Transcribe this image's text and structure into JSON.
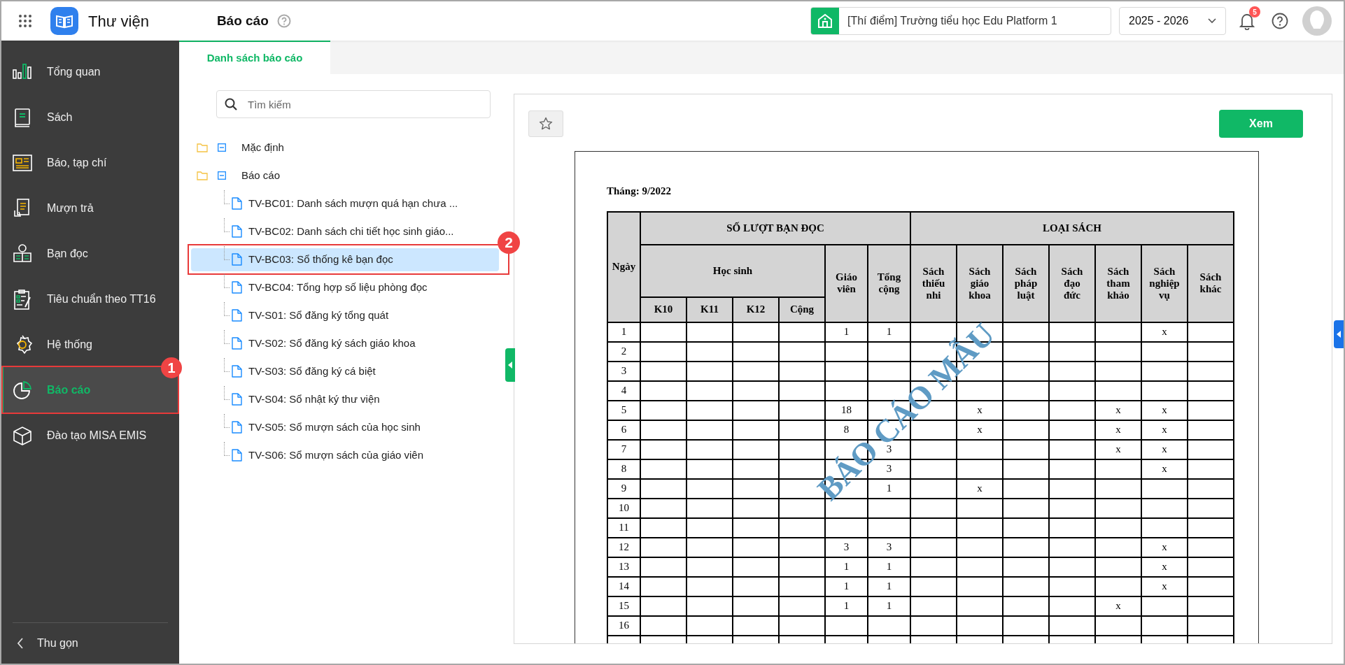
{
  "app": {
    "title": "Thư viện"
  },
  "header": {
    "page_title": "Báo cáo",
    "school": "[Thí điểm] Trường tiểu học Edu Platform 1",
    "year": "2025 - 2026",
    "notification_count": "5"
  },
  "sidebar": {
    "items": [
      {
        "label": "Tổng quan",
        "selected": false
      },
      {
        "label": "Sách",
        "selected": false
      },
      {
        "label": "Báo, tạp chí",
        "selected": false
      },
      {
        "label": "Mượn trả",
        "selected": false
      },
      {
        "label": "Bạn đọc",
        "selected": false
      },
      {
        "label": "Tiêu chuẩn theo TT16",
        "selected": false
      },
      {
        "label": "Hệ thống",
        "selected": false
      },
      {
        "label": "Báo cáo",
        "selected": true,
        "callout": "1"
      },
      {
        "label": "Đào tạo MISA EMIS",
        "selected": false
      }
    ],
    "collapse_label": "Thu gọn"
  },
  "tabs": [
    {
      "label": "Danh sách báo cáo",
      "selected": true
    }
  ],
  "search": {
    "placeholder": "Tìm kiếm"
  },
  "tree": [
    {
      "label": "Mặc định",
      "expanded": true
    },
    {
      "label": "Báo cáo",
      "expanded": true,
      "children": [
        {
          "label": "TV-BC01: Danh sách mượn quá hạn chưa ...",
          "selected": false
        },
        {
          "label": "TV-BC02: Danh sách chi tiết học sinh giáo...",
          "selected": false
        },
        {
          "label": "TV-BC03: Sổ thống kê bạn đọc",
          "selected": true,
          "callout": "2"
        },
        {
          "label": "TV-BC04: Tổng hợp số liệu phòng đọc",
          "selected": false
        },
        {
          "label": "TV-S01: Sổ đăng ký tổng quát",
          "selected": false
        },
        {
          "label": "TV-S02: Sổ đăng ký sách giáo khoa",
          "selected": false
        },
        {
          "label": "TV-S03: Sổ đăng ký cá biệt",
          "selected": false
        },
        {
          "label": "TV-S04: Sổ nhật ký thư viện",
          "selected": false
        },
        {
          "label": "TV-S05: Sổ mượn sách của học sinh",
          "selected": false
        },
        {
          "label": "TV-S06: Sổ mượn sách của giáo viên",
          "selected": false
        }
      ]
    }
  ],
  "preview": {
    "favorite": false,
    "view_button": "Xem",
    "report": {
      "month": "Tháng: 9/2022",
      "stamp": "BÁO CÁO MẪU",
      "day_header": "Ngày",
      "readers_header": "SỐ LƯỢT BẠN ĐỌC",
      "book_types_header": "LOẠI SÁCH",
      "student_header": "Học sinh",
      "student_columns": [
        "K10",
        "K11",
        "K12",
        "Cộng"
      ],
      "teacher_header": "Giáo viên",
      "total_header": "Tổng cộng",
      "book_types": [
        "Sách thiếu nhi",
        "Sách giáo khoa",
        "Sách pháp luật",
        "Sách đạo đức",
        "Sách tham khảo",
        "Sách nghiệp vụ",
        "Sách khác"
      ],
      "rows": [
        {
          "day": "1",
          "cells": [
            null,
            null,
            null,
            null,
            "1",
            "1",
            null,
            null,
            null,
            null,
            null,
            "x",
            null
          ]
        },
        {
          "day": "2",
          "cells": [
            null,
            null,
            null,
            null,
            null,
            null,
            null,
            null,
            null,
            null,
            null,
            null,
            null
          ]
        },
        {
          "day": "3",
          "cells": [
            null,
            null,
            null,
            null,
            null,
            null,
            null,
            null,
            null,
            null,
            null,
            null,
            null
          ]
        },
        {
          "day": "4",
          "cells": [
            null,
            null,
            null,
            null,
            null,
            null,
            null,
            null,
            null,
            null,
            null,
            null,
            null
          ]
        },
        {
          "day": "5",
          "cells": [
            null,
            null,
            null,
            null,
            "18",
            null,
            null,
            "x",
            null,
            null,
            "x",
            "x",
            null
          ]
        },
        {
          "day": "6",
          "cells": [
            null,
            null,
            null,
            null,
            "8",
            null,
            null,
            "x",
            null,
            null,
            "x",
            "x",
            null
          ]
        },
        {
          "day": "7",
          "cells": [
            null,
            null,
            null,
            null,
            null,
            "3",
            null,
            null,
            null,
            null,
            "x",
            "x",
            null
          ]
        },
        {
          "day": "8",
          "cells": [
            null,
            null,
            null,
            null,
            null,
            "3",
            null,
            null,
            null,
            null,
            null,
            "x",
            null
          ]
        },
        {
          "day": "9",
          "cells": [
            null,
            null,
            null,
            null,
            null,
            "1",
            null,
            "x",
            null,
            null,
            null,
            null,
            null
          ]
        },
        {
          "day": "10",
          "cells": [
            null,
            null,
            null,
            null,
            null,
            null,
            null,
            null,
            null,
            null,
            null,
            null,
            null
          ]
        },
        {
          "day": "11",
          "cells": [
            null,
            null,
            null,
            null,
            null,
            null,
            null,
            null,
            null,
            null,
            null,
            null,
            null
          ]
        },
        {
          "day": "12",
          "cells": [
            null,
            null,
            null,
            null,
            "3",
            "3",
            null,
            null,
            null,
            null,
            null,
            "x",
            null
          ]
        },
        {
          "day": "13",
          "cells": [
            null,
            null,
            null,
            null,
            "1",
            "1",
            null,
            null,
            null,
            null,
            null,
            "x",
            null
          ]
        },
        {
          "day": "14",
          "cells": [
            null,
            null,
            null,
            null,
            "1",
            "1",
            null,
            null,
            null,
            null,
            null,
            "x",
            null
          ]
        },
        {
          "day": "15",
          "cells": [
            null,
            null,
            null,
            null,
            "1",
            "1",
            null,
            null,
            null,
            null,
            "x",
            null,
            null
          ]
        },
        {
          "day": "16",
          "cells": [
            null,
            null,
            null,
            null,
            null,
            null,
            null,
            null,
            null,
            null,
            null,
            null,
            null
          ]
        }
      ]
    }
  }
}
